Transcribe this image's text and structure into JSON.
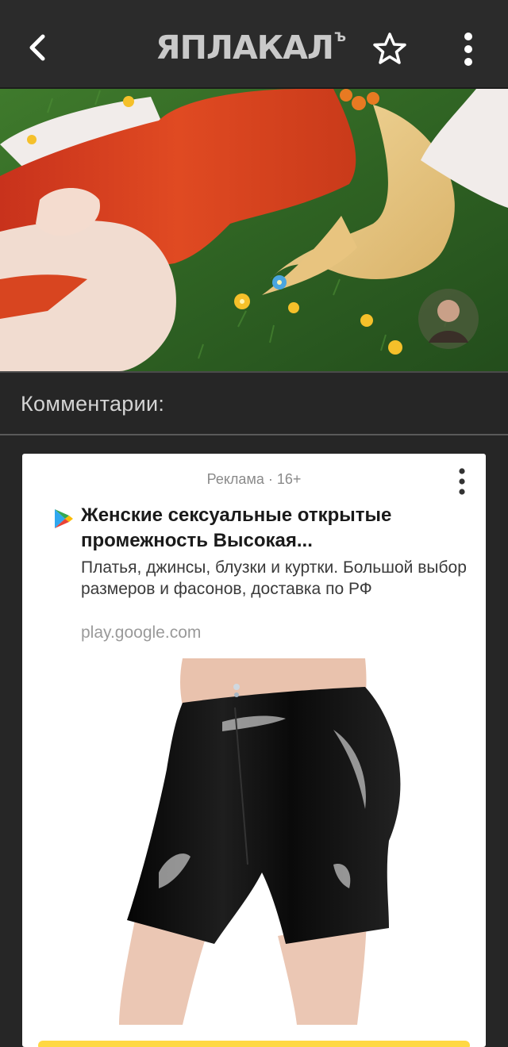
{
  "header": {
    "logo_text": "ЯПЛАКАЛ",
    "logo_suffix": "Ъ",
    "back_icon": "chevron-left-icon",
    "star_icon": "star-outline-icon",
    "menu_icon": "more-vertical-icon"
  },
  "comments": {
    "title": "Комментарии:"
  },
  "ad": {
    "meta": "Реклама · 16+",
    "title": "Женские сексуальные открытые промежность Высокая...",
    "description": "Платья, джинсы, блузки и куртки. Большой выбор размеров и фасонов, доставка по РФ",
    "domain": "play.google.com",
    "source_icon": "google-play-icon",
    "menu_icon": "more-vertical-icon"
  },
  "colors": {
    "topbar": "#2b2b2b",
    "background": "#262626",
    "logo": "#c9c9c9",
    "ad_cta": "#ffd843"
  }
}
